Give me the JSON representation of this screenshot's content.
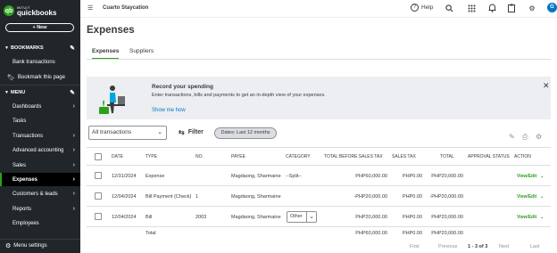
{
  "sidebar": {
    "logo_top": "INTUIT",
    "logo_bottom": "quickbooks",
    "new_label": "+ New",
    "bookmarks_label": "BOOKMARKS",
    "bookmark_items": [
      "Bank transactions",
      "Bookmark this page"
    ],
    "menu_label": "MENU",
    "menu_items": [
      "Dashboards",
      "Tasks",
      "Transactions",
      "Advanced accounting",
      "Sales",
      "Expenses",
      "Customers & leads",
      "Reports",
      "Employees"
    ],
    "active_item": "Expenses",
    "menu_settings": "Menu settings"
  },
  "topbar": {
    "company": "Cuarto Staycation",
    "help": "Help",
    "avatar": "G"
  },
  "page": {
    "title": "Expenses",
    "tabs": [
      "Expenses",
      "Suppliers"
    ]
  },
  "banner": {
    "title": "Record your spending",
    "description": "Enter transactions, bills and payments to get an in-depth view of your expenses.",
    "link": "Show me how"
  },
  "filters": {
    "select_value": "All transactions",
    "filter_label": "Filter",
    "date_pill": "Dates: Last 12 months"
  },
  "table": {
    "headers": [
      "DATE",
      "TYPE",
      "NO.",
      "PAYEE",
      "CATEGORY",
      "TOTAL BEFORE SALES TAX",
      "SALES TAX",
      "TOTAL",
      "APPROVAL STATUS",
      "ACTION"
    ],
    "rows": [
      {
        "date": "12/31/2024",
        "type": "Expense",
        "no": "",
        "payee": "Magdaong, Sharmaine",
        "category": "--Split--",
        "before_tax": "PHP60,000.00",
        "tax": "PHP0.00",
        "total": "PHP20,000.00",
        "approval": "",
        "action": "View/Edit"
      },
      {
        "date": "12/04/2024",
        "type": "Bill Payment (Check)",
        "no": "1",
        "payee": "Magdaong, Sharmaine",
        "category": "",
        "before_tax": "-PHP20,000.00",
        "tax": "PHP0.00",
        "total": "-PHP20,000.00",
        "approval": "",
        "action": "View/Edit"
      },
      {
        "date": "12/04/2024",
        "type": "Bill",
        "no": "2003",
        "payee": "Magdaong, Sharmaine",
        "category": "Other",
        "before_tax": "PHP20,000.00",
        "tax": "PHP0.00",
        "total": "PHP20,000.00",
        "approval": "",
        "action": "View/Edit"
      }
    ],
    "total_label": "Total",
    "total_before_tax": "PHP60,000.00",
    "total_tax": "PHP0.00",
    "total_total": "PHP20,000.00"
  },
  "pagination": {
    "first": "First",
    "previous": "Previous",
    "range": "1 - 3 of 3",
    "next": "Next",
    "last": "Last"
  }
}
